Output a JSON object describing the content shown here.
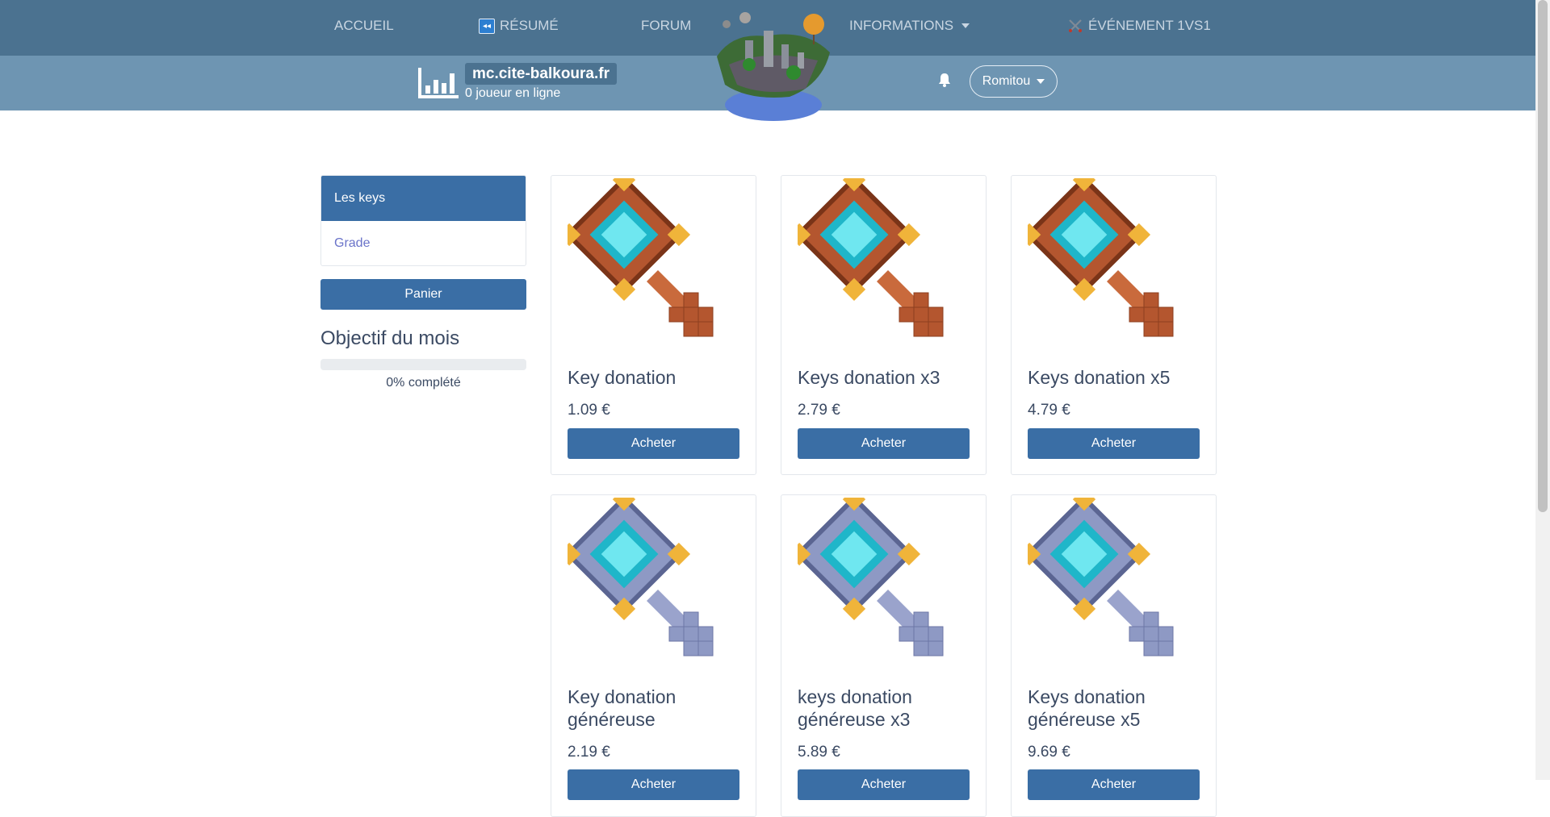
{
  "nav": {
    "home": "ACCUEIL",
    "resume": "RÉSUMÉ",
    "forum": "FORUM",
    "informations": "INFORMATIONS",
    "event": "ÉVÉNEMENT 1VS1"
  },
  "header": {
    "server_ip": "mc.cite-balkoura.fr",
    "online_count": "0 joueur en ligne",
    "username": "Romitou"
  },
  "sidebar": {
    "items": [
      {
        "label": "Les keys",
        "active": true
      },
      {
        "label": "Grade",
        "active": false
      }
    ],
    "cart_label": "Panier",
    "goal_title": "Objectif du mois",
    "goal_progress": 0,
    "goal_text": "0% complété"
  },
  "products": [
    {
      "title": "Key donation",
      "price": "1.09 €",
      "button": "Acheter",
      "variant": "bronze"
    },
    {
      "title": "Keys donation x3",
      "price": "2.79 €",
      "button": "Acheter",
      "variant": "bronze"
    },
    {
      "title": "Keys donation x5",
      "price": "4.79 €",
      "button": "Acheter",
      "variant": "bronze"
    },
    {
      "title": "Key donation généreuse",
      "price": "2.19 €",
      "button": "Acheter",
      "variant": "silver"
    },
    {
      "title": "keys donation généreuse x3",
      "price": "5.89 €",
      "button": "Acheter",
      "variant": "silver"
    },
    {
      "title": "Keys donation généreuse x5",
      "price": "9.69 €",
      "button": "Acheter",
      "variant": "silver"
    }
  ],
  "colors": {
    "nav_bg": "#4b7290",
    "subbar_bg": "#6e95b2",
    "primary": "#3a6ea5"
  }
}
